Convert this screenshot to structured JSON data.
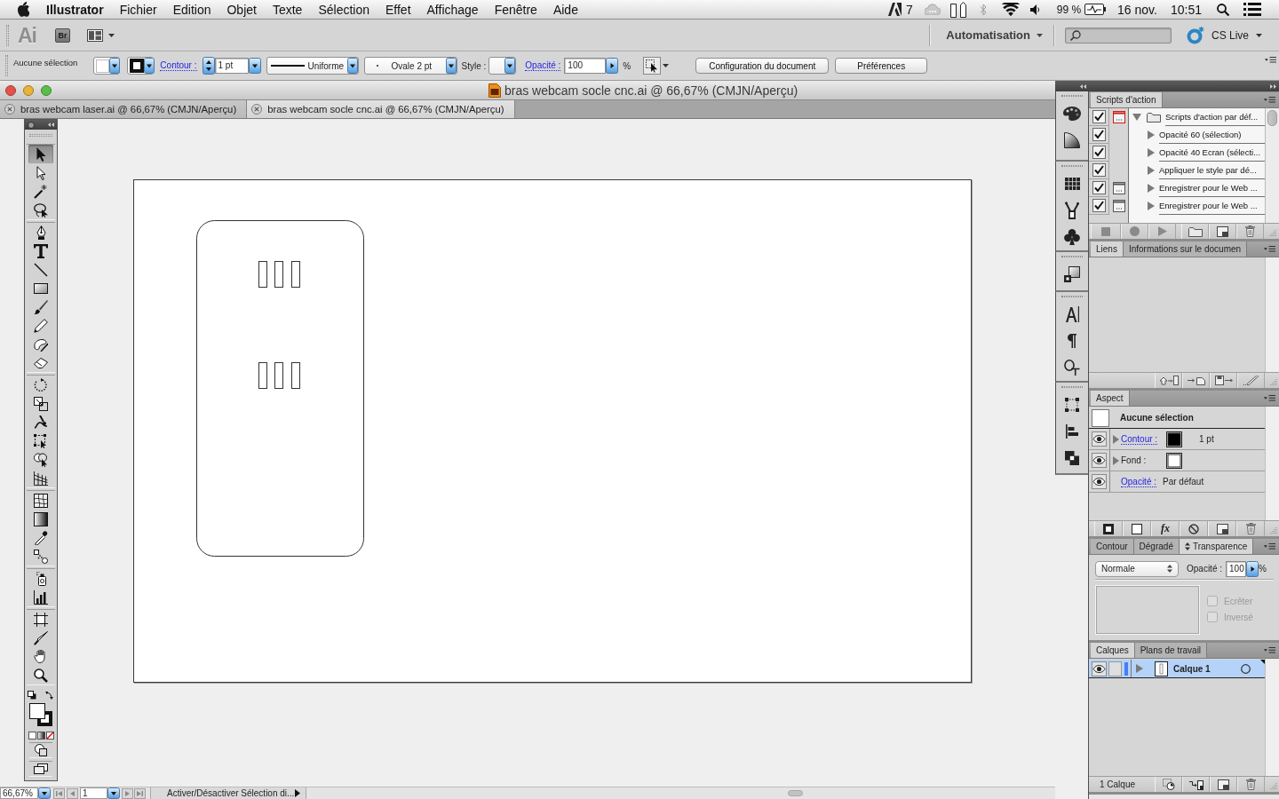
{
  "menu_bar": {
    "app_name": "Illustrator",
    "menus": [
      "Fichier",
      "Edition",
      "Objet",
      "Texte",
      "Sélection",
      "Effet",
      "Affichage",
      "Fenêtre",
      "Aide"
    ],
    "status": {
      "notification_count": "7",
      "battery": "99 %",
      "date": "16 nov.",
      "time": "10:51"
    }
  },
  "app_bar": {
    "logo": "Ai",
    "bridge": "Br",
    "workspace": "Automatisation",
    "cs_live": "CS Live"
  },
  "control_bar": {
    "selection": "Aucune sélection",
    "stroke_link": "Contour :",
    "stroke_weight": "1 pt",
    "stroke_profile": "Uniforme",
    "brush": "Ovale 2 pt",
    "style_label": "Style :",
    "opacity_link": "Opacité :",
    "opacity": "100",
    "percent": "%",
    "buttons": [
      "Configuration du document",
      "Préférences"
    ]
  },
  "document": {
    "title": "bras webcam socle cnc.ai @ 66,67% (CMJN/Aperçu)",
    "tabs": [
      {
        "label": "bras webcam laser.ai @ 66,67% (CMJN/Aperçu)",
        "selected": false
      },
      {
        "label": "bras webcam socle cnc.ai @ 66,67% (CMJN/Aperçu)",
        "selected": true
      }
    ]
  },
  "toolbox": {
    "groups": [
      {
        "tools": [
          {
            "kind": "selection",
            "selected": true
          },
          {
            "kind": "direct-selection",
            "selected": false
          },
          {
            "kind": "magic-wand",
            "selected": false
          },
          {
            "kind": "lasso",
            "selected": false
          }
        ]
      },
      {
        "tools": [
          {
            "kind": "pen",
            "selected": false
          },
          {
            "kind": "type",
            "selected": false
          },
          {
            "kind": "line",
            "selected": false
          },
          {
            "kind": "rectangle",
            "selected": false
          },
          {
            "kind": "paintbrush",
            "selected": false
          },
          {
            "kind": "pencil",
            "selected": false
          },
          {
            "kind": "blob-brush",
            "selected": false
          },
          {
            "kind": "eraser",
            "selected": false
          }
        ]
      },
      {
        "tools": [
          {
            "kind": "rotate",
            "selected": false
          },
          {
            "kind": "scale",
            "selected": false
          },
          {
            "kind": "warp",
            "selected": false
          },
          {
            "kind": "free-transform",
            "selected": false
          },
          {
            "kind": "shape-builder",
            "selected": false
          },
          {
            "kind": "perspective-grid",
            "selected": false
          }
        ]
      },
      {
        "tools": [
          {
            "kind": "mesh",
            "selected": false
          },
          {
            "kind": "gradient",
            "selected": false
          },
          {
            "kind": "eyedropper",
            "selected": false
          },
          {
            "kind": "blend",
            "selected": false
          }
        ]
      },
      {
        "tools": [
          {
            "kind": "symbol-sprayer",
            "selected": false
          },
          {
            "kind": "column-graph",
            "selected": false
          }
        ]
      },
      {
        "tools": [
          {
            "kind": "artboard",
            "selected": false
          },
          {
            "kind": "slice",
            "selected": false
          },
          {
            "kind": "hand",
            "selected": false
          },
          {
            "kind": "zoom",
            "selected": false
          }
        ]
      }
    ]
  },
  "panels": {
    "actions": {
      "tabs": [
        {
          "label": "Scripts d'action",
          "selected": true,
          "options_toggle": false
        }
      ],
      "items": [
        {
          "kind": "set",
          "label": "Scripts d'action par déf...",
          "checked": true,
          "dialog": true,
          "dialog_mixed": true,
          "expanded": true
        },
        {
          "kind": "action",
          "label": "Opacité 60 (sélection)",
          "checked": true,
          "dialog": false,
          "dialog_mixed": false,
          "expanded": false
        },
        {
          "kind": "action",
          "label": "Opacité 40 Ecran (sélecti...",
          "checked": true,
          "dialog": false,
          "dialog_mixed": false,
          "expanded": false
        },
        {
          "kind": "action",
          "label": "Appliquer le style par dé...",
          "checked": true,
          "dialog": false,
          "dialog_mixed": false,
          "expanded": false
        },
        {
          "kind": "action",
          "label": "Enregistrer pour le Web ...",
          "checked": true,
          "dialog": true,
          "dialog_mixed": false,
          "expanded": false
        },
        {
          "kind": "action",
          "label": "Enregistrer pour le Web ...",
          "checked": true,
          "dialog": true,
          "dialog_mixed": false,
          "expanded": false
        }
      ]
    },
    "links": {
      "tabs": [
        {
          "label": "Liens",
          "selected": true,
          "options_toggle": false
        },
        {
          "label": "Informations sur le documen",
          "selected": false,
          "options_toggle": false
        }
      ]
    },
    "appearance": {
      "tabs": [
        {
          "label": "Aspect",
          "selected": true,
          "options_toggle": false
        }
      ],
      "header": "Aucune sélection",
      "rows": [
        {
          "kind": "stroke",
          "label": "Contour :",
          "link": true,
          "visible": true,
          "color": "#000000",
          "value": "1 pt"
        },
        {
          "kind": "fill",
          "label": "Fond :",
          "link": false,
          "visible": true,
          "color": "#ffffff"
        },
        {
          "kind": "opacity",
          "label": "Opacité :",
          "link": true,
          "visible": true,
          "value": "Par défaut"
        }
      ],
      "effects": "fx"
    },
    "transparency": {
      "tabs": [
        {
          "label": "Contour",
          "selected": false,
          "options_toggle": false
        },
        {
          "label": "Dégradé",
          "selected": false,
          "options_toggle": false
        },
        {
          "label": "Transparence",
          "selected": true,
          "options_toggle": true
        }
      ],
      "blend_mode": "Normale",
      "opacity_label": "Opacité :",
      "opacity": "100",
      "percent": "%",
      "options": [
        {
          "label": "Ecrêter",
          "checked": false,
          "disabled": true
        },
        {
          "label": "Inversé",
          "checked": false,
          "disabled": true
        }
      ]
    },
    "layers": {
      "tabs": [
        {
          "label": "Calques",
          "selected": true,
          "options_toggle": false
        },
        {
          "label": "Plans de travail",
          "selected": false,
          "options_toggle": false
        }
      ],
      "items": [
        {
          "name": "Calque 1",
          "visible": true,
          "locked": false,
          "color": "#4a7cf6",
          "selected": true,
          "expanded": false
        }
      ],
      "count": "1 Calque"
    }
  },
  "status_bar": {
    "zoom": "66,67%",
    "page": "1",
    "message": "Activer/Désactiver Sélection di..."
  }
}
